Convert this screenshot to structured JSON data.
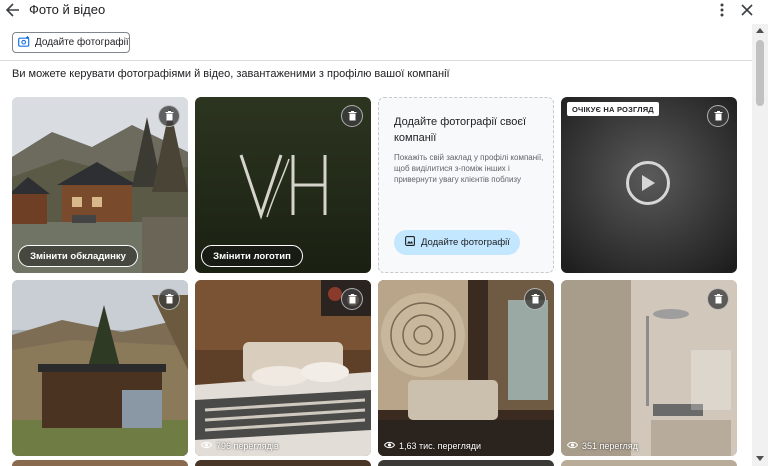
{
  "header": {
    "title": "Фото й відео",
    "back_icon": "arrow-back-icon",
    "more_icon": "more-vert-icon",
    "close_icon": "close-icon"
  },
  "toolbar": {
    "add_photos_label": "Додайте фотографії",
    "add_photos_icon": "add-photo-icon"
  },
  "subtitle": "Ви можете керувати фотографіями й відео, завантаженими з профілю вашої компанії",
  "tiles": {
    "cover": {
      "button_label": "Змінити обкладинку"
    },
    "logo": {
      "button_label": "Змінити логотип"
    },
    "promo": {
      "title": "Додайте фотографії своєї компанії",
      "text": "Покажіть свій заклад у профілі компанії, щоб виділитися з-поміж інших і привернути увагу клієнтів поблизу",
      "button_label": "Додайте фотографії"
    },
    "video": {
      "badge": "ОЧІКУЄ НА РОЗГЛЯД"
    },
    "bedroom": {
      "views": "796 переглядів"
    },
    "lounge": {
      "views": "1,63 тис. перегляди"
    },
    "shower": {
      "views": "351 перегляд"
    }
  },
  "colors": {
    "accent_button": "#c2e7ff",
    "text_primary": "#202124",
    "text_secondary": "#5f6368"
  }
}
